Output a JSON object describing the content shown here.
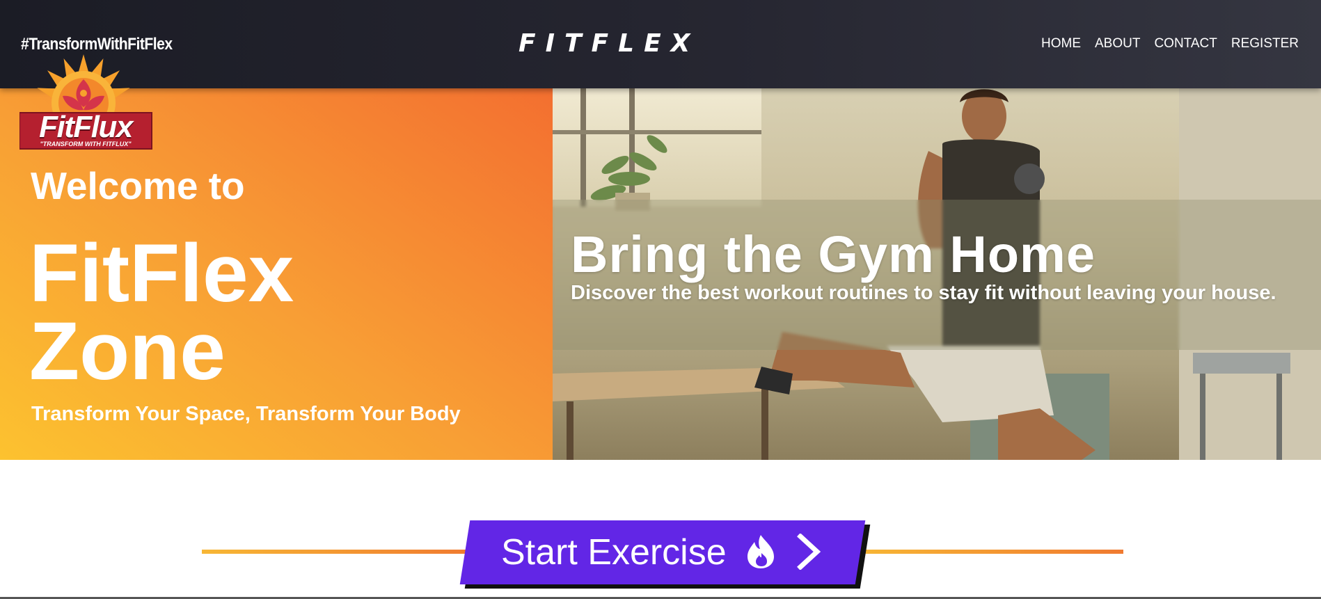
{
  "header": {
    "hashtag": "#TransformWithFitFlex",
    "brand": "FITFLEX",
    "nav": [
      {
        "label": "HOME"
      },
      {
        "label": "ABOUT"
      },
      {
        "label": "CONTACT"
      },
      {
        "label": "REGISTER"
      }
    ]
  },
  "logo": {
    "wordmark": "FitFlux",
    "tagline": "\"TRANSFORM WITH FITFLUX\""
  },
  "hero_left": {
    "welcome": "Welcome to",
    "title_line1": "FitFlex",
    "title_line2": "Zone",
    "tagline": "Transform Your Space, Transform Your Body"
  },
  "hero_right": {
    "title": "Bring the Gym Home",
    "description": "Discover the best workout routines to stay fit without leaving your house."
  },
  "cta": {
    "label": "Start Exercise",
    "icon": "flame-icon",
    "arrow_icon": "chevron-right-icon"
  },
  "colors": {
    "header_bg": "#1b1c25",
    "hero_gradient_start": "#fcc22f",
    "hero_gradient_end": "#f36f30",
    "cta_bg": "#6226e6",
    "logo_red": "#b5202f",
    "logo_orange": "#f79a2b"
  }
}
